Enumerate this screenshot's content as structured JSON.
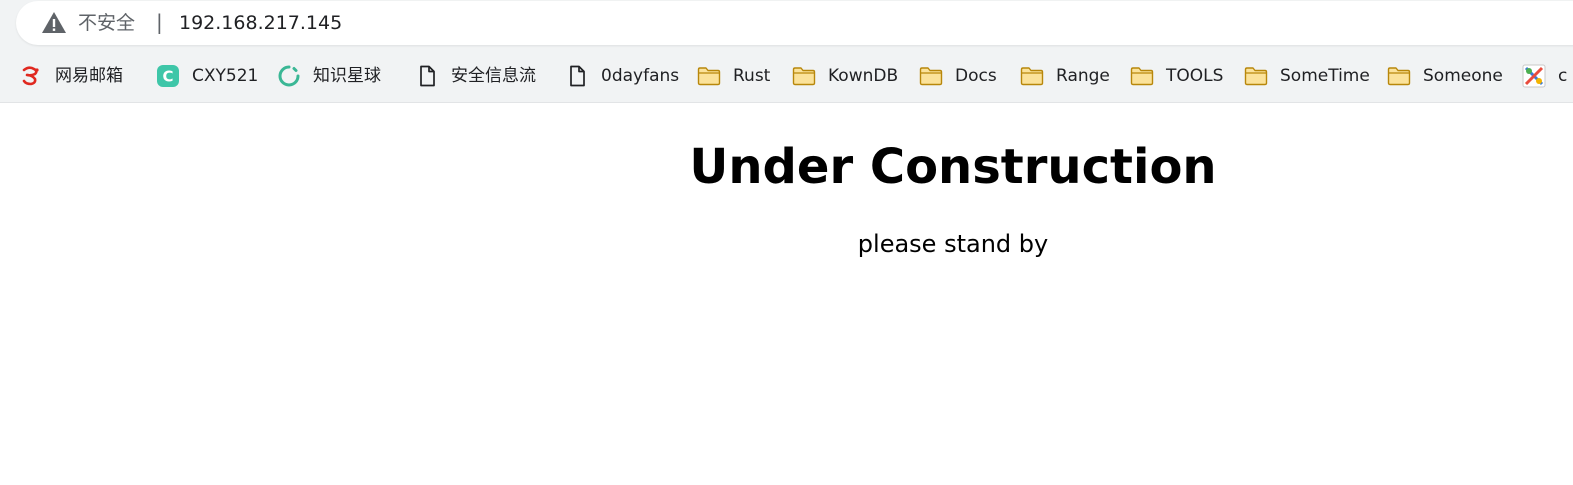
{
  "omnibox": {
    "security_label": "不安全",
    "separator": "|",
    "url": "192.168.217.145"
  },
  "bookmarks": [
    {
      "label": "网易邮箱",
      "icon": "netease-mail-icon"
    },
    {
      "label": "CXY521",
      "icon": "cxy-c-icon"
    },
    {
      "label": "知识星球",
      "icon": "zsxq-ring-icon"
    },
    {
      "label": "安全信息流",
      "icon": "page-icon"
    },
    {
      "label": "0dayfans",
      "icon": "page-icon"
    },
    {
      "label": "Rust",
      "icon": "folder-icon"
    },
    {
      "label": "KownDB",
      "icon": "folder-icon"
    },
    {
      "label": "Docs",
      "icon": "folder-icon"
    },
    {
      "label": "Range",
      "icon": "folder-icon"
    },
    {
      "label": "TOOLS",
      "icon": "folder-icon"
    },
    {
      "label": "SomeTime",
      "icon": "folder-icon"
    },
    {
      "label": "Someone",
      "icon": "folder-icon"
    },
    {
      "label": "c",
      "icon": "tools-icon"
    }
  ],
  "colors": {
    "folder_fill": "#fbe29a",
    "folder_stroke": "#b8870b",
    "cxy_green": "#3ec6a8",
    "ring_green": "#3ab795",
    "warn_gray": "#5f6368"
  },
  "page": {
    "title": "Under Construction",
    "subtitle": "please stand by"
  }
}
